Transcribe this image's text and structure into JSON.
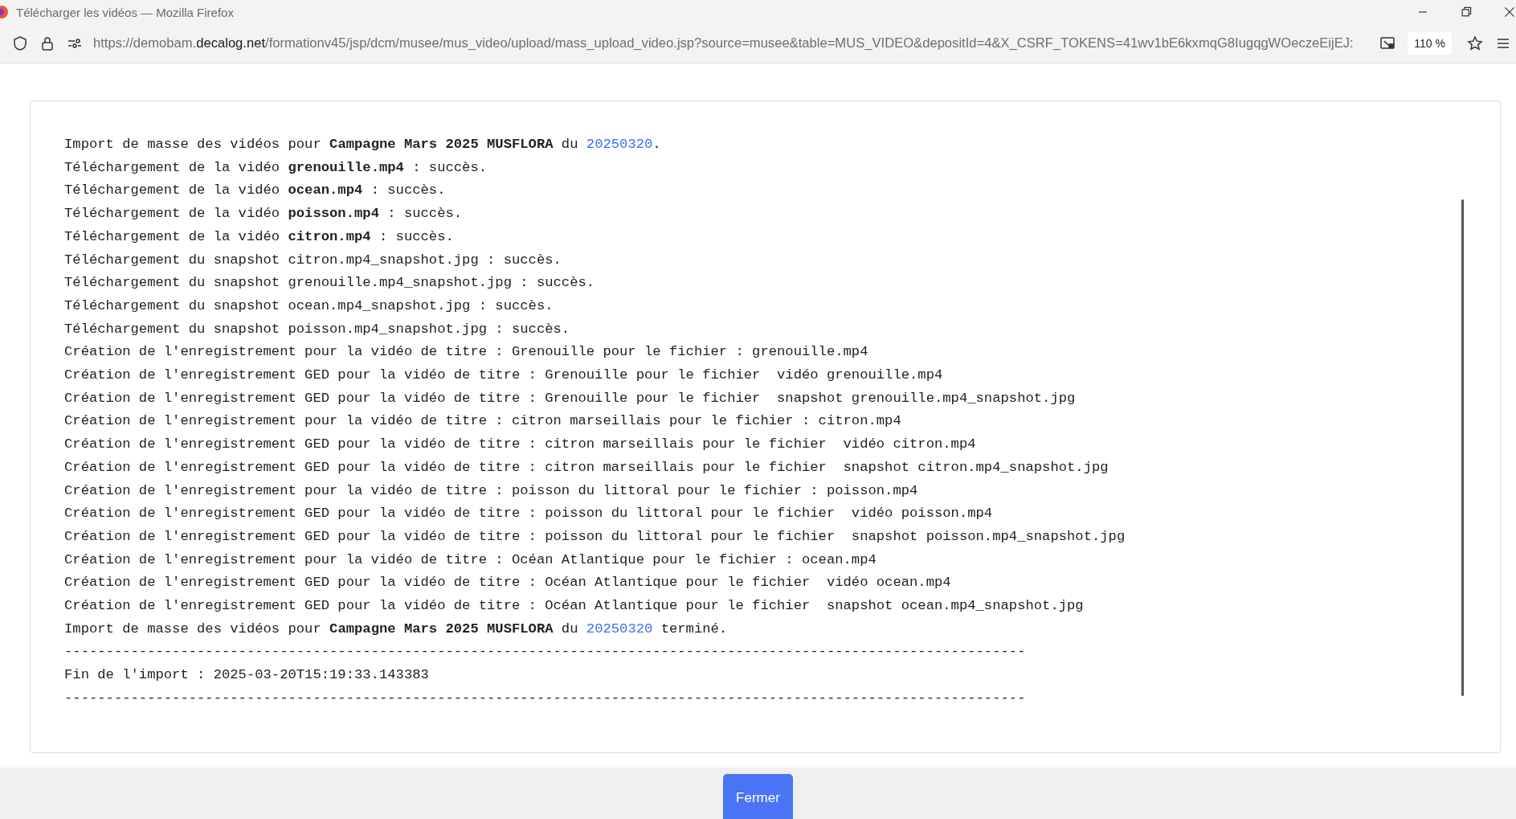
{
  "window": {
    "title": "Télécharger les vidéos — Mozilla Firefox"
  },
  "address_bar": {
    "url_before": "https://demobam.",
    "url_domain": "decalog.net",
    "url_after": "/formationv45/jsp/dcm/musee/mus_video/upload/mass_upload_video.jsp?source=musee&table=MUS_VIDEO&depositId=4&X_CSRF_TOKENS=41wv1bE6kxmqG8IugqgWOeczeEijEJ:",
    "zoom": "110 %"
  },
  "log_lines": [
    {
      "parts": [
        {
          "kind": "text",
          "text": "Import de masse des vidéos pour **Campagne Mars 2025 MUSFLORA** du "
        },
        {
          "kind": "link",
          "text": "20250320"
        },
        {
          "kind": "text",
          "text": "."
        }
      ]
    },
    {
      "parts": [
        {
          "kind": "text",
          "text": "Téléchargement de la vidéo **grenouille.mp4** : succès."
        }
      ]
    },
    {
      "parts": [
        {
          "kind": "text",
          "text": "Téléchargement de la vidéo **ocean.mp4** : succès."
        }
      ]
    },
    {
      "parts": [
        {
          "kind": "text",
          "text": "Téléchargement de la vidéo **poisson.mp4** : succès."
        }
      ]
    },
    {
      "parts": [
        {
          "kind": "text",
          "text": "Téléchargement de la vidéo **citron.mp4** : succès."
        }
      ]
    },
    {
      "parts": [
        {
          "kind": "text",
          "text": "Téléchargement du snapshot citron.mp4_snapshot.jpg : succès."
        }
      ]
    },
    {
      "parts": [
        {
          "kind": "text",
          "text": "Téléchargement du snapshot grenouille.mp4_snapshot.jpg : succès."
        }
      ]
    },
    {
      "parts": [
        {
          "kind": "text",
          "text": "Téléchargement du snapshot ocean.mp4_snapshot.jpg : succès."
        }
      ]
    },
    {
      "parts": [
        {
          "kind": "text",
          "text": "Téléchargement du snapshot poisson.mp4_snapshot.jpg : succès."
        }
      ]
    },
    {
      "parts": [
        {
          "kind": "text",
          "text": "Création de l'enregistrement pour la vidéo de titre : Grenouille pour le fichier : grenouille.mp4"
        }
      ]
    },
    {
      "parts": [
        {
          "kind": "text",
          "text": "Création de l'enregistrement GED pour la vidéo de titre : Grenouille pour le fichier  vidéo grenouille.mp4"
        }
      ]
    },
    {
      "parts": [
        {
          "kind": "text",
          "text": "Création de l'enregistrement GED pour la vidéo de titre : Grenouille pour le fichier  snapshot grenouille.mp4_snapshot.jpg"
        }
      ]
    },
    {
      "parts": [
        {
          "kind": "text",
          "text": "Création de l'enregistrement pour la vidéo de titre : citron marseillais pour le fichier : citron.mp4"
        }
      ]
    },
    {
      "parts": [
        {
          "kind": "text",
          "text": "Création de l'enregistrement GED pour la vidéo de titre : citron marseillais pour le fichier  vidéo citron.mp4"
        }
      ]
    },
    {
      "parts": [
        {
          "kind": "text",
          "text": "Création de l'enregistrement GED pour la vidéo de titre : citron marseillais pour le fichier  snapshot citron.mp4_snapshot.jpg"
        }
      ]
    },
    {
      "parts": [
        {
          "kind": "text",
          "text": "Création de l'enregistrement pour la vidéo de titre : poisson du littoral pour le fichier : poisson.mp4"
        }
      ]
    },
    {
      "parts": [
        {
          "kind": "text",
          "text": "Création de l'enregistrement GED pour la vidéo de titre : poisson du littoral pour le fichier  vidéo poisson.mp4"
        }
      ]
    },
    {
      "parts": [
        {
          "kind": "text",
          "text": "Création de l'enregistrement GED pour la vidéo de titre : poisson du littoral pour le fichier  snapshot poisson.mp4_snapshot.jpg"
        }
      ]
    },
    {
      "parts": [
        {
          "kind": "text",
          "text": "Création de l'enregistrement pour la vidéo de titre : Océan Atlantique pour le fichier : ocean.mp4"
        }
      ]
    },
    {
      "parts": [
        {
          "kind": "text",
          "text": "Création de l'enregistrement GED pour la vidéo de titre : Océan Atlantique pour le fichier  vidéo ocean.mp4"
        }
      ]
    },
    {
      "parts": [
        {
          "kind": "text",
          "text": "Création de l'enregistrement GED pour la vidéo de titre : Océan Atlantique pour le fichier  snapshot ocean.mp4_snapshot.jpg"
        }
      ]
    },
    {
      "parts": [
        {
          "kind": "text",
          "text": "Import de masse des vidéos pour **Campagne Mars 2025 MUSFLORA** du "
        },
        {
          "kind": "link",
          "text": "20250320"
        },
        {
          "kind": "text",
          "text": " terminé."
        }
      ]
    },
    {
      "parts": [
        {
          "kind": "text",
          "text": "--------------------------------------------------------------------------------------------------------------------"
        }
      ]
    },
    {
      "parts": [
        {
          "kind": "text",
          "text": "Fin de l'import : 2025-03-20T15:19:33.143383"
        }
      ]
    },
    {
      "parts": [
        {
          "kind": "text",
          "text": "--------------------------------------------------------------------------------------------------------------------"
        }
      ]
    }
  ],
  "close_button": "Fermer"
}
